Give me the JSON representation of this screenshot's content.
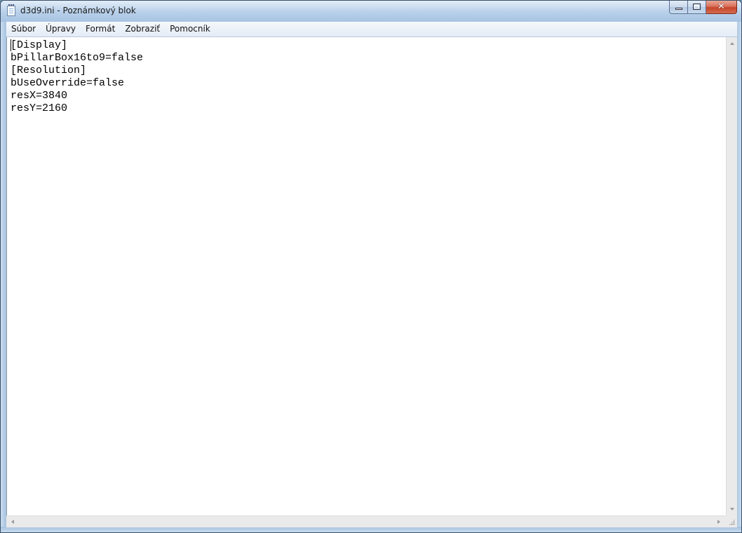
{
  "window": {
    "title": "d3d9.ini - Poznámkový blok",
    "caption_min_label": "",
    "caption_max_label": "",
    "caption_close_label": "✕"
  },
  "menu": {
    "items": [
      {
        "label": "Súbor"
      },
      {
        "label": "Úpravy"
      },
      {
        "label": "Formát"
      },
      {
        "label": "Zobraziť"
      },
      {
        "label": "Pomocník"
      }
    ]
  },
  "editor": {
    "content": "[Display]\nbPillarBox16to9=false\n[Resolution]\nbUseOverride=false\nresX=3840\nresY=2160"
  },
  "icons": {
    "app": "notepad-icon",
    "minimize": "minimize-icon",
    "maximize": "maximize-icon",
    "close": "close-icon"
  },
  "colors": {
    "titlebar": "#b9d1ea",
    "close_button": "#c4452a",
    "editor_bg": "#ffffff",
    "scrollbar": "#eaeaea"
  }
}
